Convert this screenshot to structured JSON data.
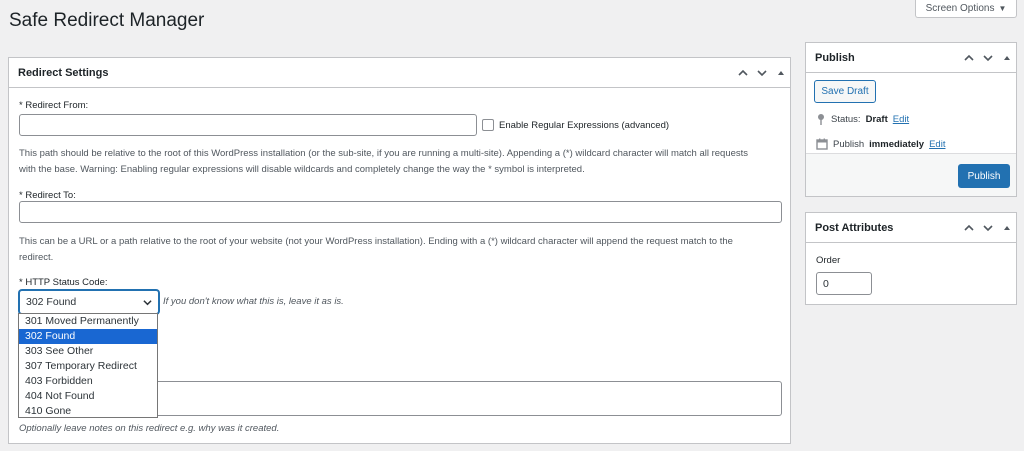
{
  "page": {
    "title": "Safe Redirect Manager"
  },
  "screen_options": {
    "label": "Screen Options"
  },
  "redirect_settings": {
    "title": "Redirect Settings",
    "redirect_from_label": "* Redirect From:",
    "redirect_from_value": "",
    "regex_label": "Enable Regular Expressions (advanced)",
    "regex_checked": false,
    "redirect_from_help_1": "This path should be relative to the root of this WordPress installation (or the sub-site, if you are running a multi-site). Appending a (*) wildcard character will match all requests",
    "redirect_from_help_2": "with the base. Warning: Enabling regular expressions will disable wildcards and completely change the way the * symbol is interpreted.",
    "redirect_to_label": "* Redirect To:",
    "redirect_to_value": "",
    "redirect_to_help_1": "This can be a URL or a path relative to the root of your website (not your WordPress installation). Ending with a (*) wildcard character will append the request match to the",
    "redirect_to_help_2": "redirect.",
    "status_code_label": "* HTTP Status Code:",
    "status_code_selected": "302 Found",
    "status_code_hint": "If you don't know what this is, leave it as is.",
    "status_code_options": [
      "301 Moved Permanently",
      "302 Found",
      "303 See Other",
      "307 Temporary Redirect",
      "403 Forbidden",
      "404 Not Found",
      "410 Gone"
    ],
    "notes_value": "",
    "notes_help": "Optionally leave notes on this redirect e.g. why was it created."
  },
  "publish": {
    "title": "Publish",
    "save_draft": "Save Draft",
    "status_label": "Status:",
    "status_value": "Draft",
    "status_edit": "Edit",
    "publish_label": "Publish",
    "publish_value": "immediately",
    "publish_edit": "Edit",
    "publish_button": "Publish"
  },
  "post_attributes": {
    "title": "Post Attributes",
    "order_label": "Order",
    "order_value": "0"
  },
  "colors": {
    "primary": "#2271b1",
    "selected_option": "#1967d2"
  }
}
